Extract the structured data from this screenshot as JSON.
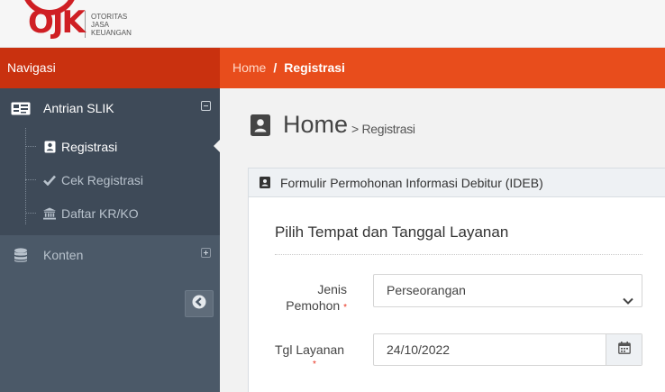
{
  "logo": {
    "letters": "OJK",
    "text": [
      "OTORITAS",
      "JASA",
      "KEUANGAN"
    ]
  },
  "nav": {
    "title": "Navigasi",
    "breadcrumb": {
      "home": "Home",
      "separator": "/",
      "current": "Registrasi"
    }
  },
  "sidebar": {
    "groups": [
      {
        "label": "Antrian SLIK",
        "icon": "id-card-icon",
        "expanded": true,
        "items": [
          {
            "label": "Registrasi",
            "icon": "address-book-icon",
            "active": true
          },
          {
            "label": "Cek Registrasi",
            "icon": "check-icon",
            "active": false
          },
          {
            "label": "Daftar KR/KO",
            "icon": "bank-icon",
            "active": false
          }
        ]
      },
      {
        "label": "Konten",
        "icon": "database-icon",
        "expanded": false
      }
    ],
    "collapse_icon": "arrow-circle-left-icon"
  },
  "page": {
    "title": "Home",
    "subtitle": "> Registrasi"
  },
  "form": {
    "panel_title": "Formulir Permohonan Informasi Debitur (IDEB)",
    "section_title": "Pilih Tempat dan Tanggal Layanan",
    "fields": {
      "jenis_label_1": "Jenis",
      "jenis_label_2": "Pemohon",
      "jenis_value": "Perseorangan",
      "tgl_label": "Tgl Layanan",
      "tgl_value": "24/10/2022",
      "required_mark": "*"
    }
  },
  "colors": {
    "brand_red": "#cf1f24",
    "navbar": "#e84d1c",
    "navbar_dark": "#c9310f",
    "sidebar": "#4b5968"
  }
}
